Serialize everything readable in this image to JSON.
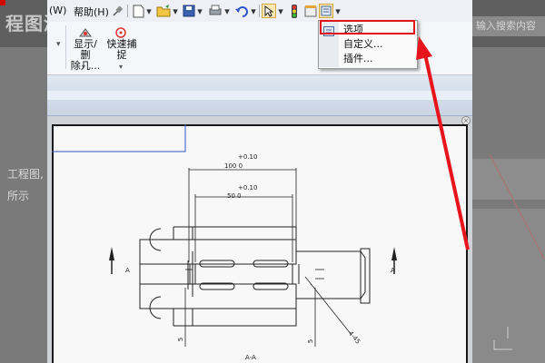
{
  "background_page": {
    "title_fragment": "程图浓",
    "search_placeholder": "输入搜索内容",
    "side_text_1": "工程图,",
    "side_text_2": "所示"
  },
  "menubar": {
    "window_menu": "(W)",
    "help_menu": "帮助(H)"
  },
  "toolbar": {
    "icons": [
      "pin-icon",
      "new-document-icon",
      "open-folder-icon",
      "save-icon",
      "print-icon",
      "undo-icon",
      "select-pointer-icon",
      "traffic-light-icon",
      "options-gear-icon",
      "customize-icon"
    ]
  },
  "ribbon": {
    "show_hide_label_1": "显示/删",
    "show_hide_label_2": "除几...",
    "quick_snap_label_1": "快速捕",
    "quick_snap_label_2": "捉"
  },
  "dropdown": {
    "items": [
      {
        "label": "选项"
      },
      {
        "label": "自定义..."
      },
      {
        "label": "插件..."
      }
    ],
    "highlighted_index": 0
  },
  "drawing": {
    "dim_top_tol": "+0.10",
    "dim_top_value": "100 0",
    "dim_mid_tol": "+0.10",
    "dim_mid_value": "50 0",
    "section_label_left": "A",
    "section_label_right": "A",
    "section_name": "A-A",
    "angle_label": "4-45",
    "small_label": "5"
  },
  "colors": {
    "highlight": "#e0131a",
    "arrow": "#e8141c",
    "accent": "#2f56c8"
  }
}
